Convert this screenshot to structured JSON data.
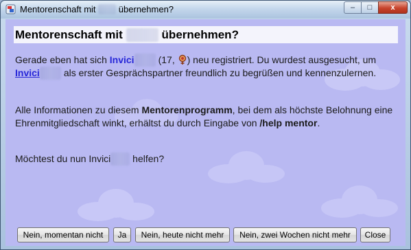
{
  "window": {
    "title_prefix": "Mentorenschaft mit",
    "title_hidden": "xxxx",
    "title_suffix": "übernehmen?"
  },
  "heading": {
    "prefix": "Mentorenschaft mit",
    "hidden": "xxxxx",
    "suffix": "übernehmen?"
  },
  "message": {
    "p1_a": "Gerade eben hat sich ",
    "user_name": "Invici",
    "user_hidden": "xxxx",
    "p1_b": " (17, ",
    "p1_c": ") neu registriert. Du wurdest ausgesucht, um ",
    "p1_d": " als erster Gesprächspartner freundlich zu begrüßen und kennenzulernen.",
    "p2_a": "Alle Informationen zu diesem ",
    "p2_bold": "Mentorenprogramm",
    "p2_b": ", bei dem als höchste Belohnung eine Ehrenmitgliedschaft winkt, erhältst du durch Eingabe von ",
    "p2_cmd": "/help mentor",
    "p2_c": ".",
    "p3_a": "Möchtest du nun Invici",
    "p3_hidden": "xxxx",
    "p3_b": " helfen?"
  },
  "buttons": {
    "not_now": "Nein, momentan nicht",
    "yes": "Ja",
    "not_today": "Nein, heute nicht mehr",
    "not_two_weeks": "Nein, zwei Wochen nicht mehr",
    "close": "Close"
  },
  "titlebar_buttons": {
    "minimize": "–",
    "maximize": "□",
    "close": "x"
  },
  "colors": {
    "background": "#b9b9f2",
    "heading_bar": "#f4f4fc",
    "link": "#2727d8"
  }
}
